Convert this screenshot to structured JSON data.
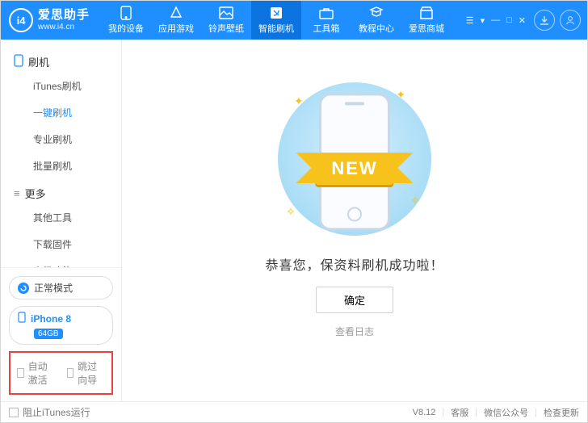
{
  "brand": {
    "name": "爱思助手",
    "site": "www.i4.cn",
    "logo_mark": "i4"
  },
  "tabs": [
    {
      "label": "我的设备"
    },
    {
      "label": "应用游戏"
    },
    {
      "label": "铃声壁纸"
    },
    {
      "label": "智能刷机"
    },
    {
      "label": "工具箱"
    },
    {
      "label": "教程中心"
    },
    {
      "label": "爱思商城"
    }
  ],
  "sidebar": {
    "sections": [
      {
        "title": "刷机",
        "items": [
          "iTunes刷机",
          "一键刷机",
          "专业刷机",
          "批量刷机"
        ]
      },
      {
        "title": "更多",
        "items": [
          "其他工具",
          "下载固件",
          "高级功能"
        ]
      }
    ],
    "mode_label": "正常模式",
    "device": {
      "name": "iPhone 8",
      "storage": "64GB"
    },
    "options": {
      "auto_activate": "自动激活",
      "skip_guide": "跳过向导"
    }
  },
  "main": {
    "ribbon": "NEW",
    "success": "恭喜您，保资料刷机成功啦！",
    "ok": "确定",
    "log": "查看日志"
  },
  "statusbar": {
    "block_itunes": "阻止iTunes运行",
    "version": "V8.12",
    "support": "客服",
    "wechat": "微信公众号",
    "update": "检查更新"
  }
}
